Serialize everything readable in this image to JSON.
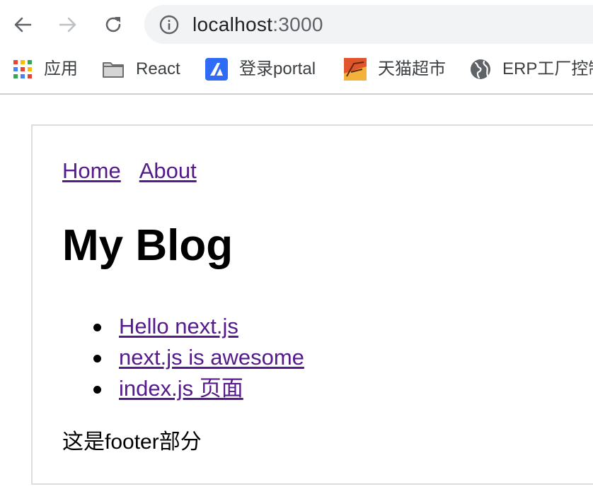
{
  "browser": {
    "url_host": "localhost",
    "url_port": ":3000",
    "bookmarks": [
      {
        "label": "应用",
        "icon": "apps-grid-icon"
      },
      {
        "label": "React",
        "icon": "folder-icon"
      },
      {
        "label": "登录portal",
        "icon": "portal-logo-icon"
      },
      {
        "label": "天猫超市",
        "icon": "tmall-icon"
      },
      {
        "label": "ERP工厂控制",
        "icon": "globe-icon"
      }
    ]
  },
  "page": {
    "nav": [
      {
        "label": "Home"
      },
      {
        "label": "About"
      }
    ],
    "title": "My Blog",
    "posts": [
      {
        "label": "Hello next.js"
      },
      {
        "label": "next.js is awesome"
      },
      {
        "label": "index.js 页面"
      }
    ],
    "footer": "这是footer部分"
  },
  "colors": {
    "link_visited": "#551a8b",
    "omnibox_bg": "#f1f3f4",
    "frame_border": "#dddddd"
  }
}
